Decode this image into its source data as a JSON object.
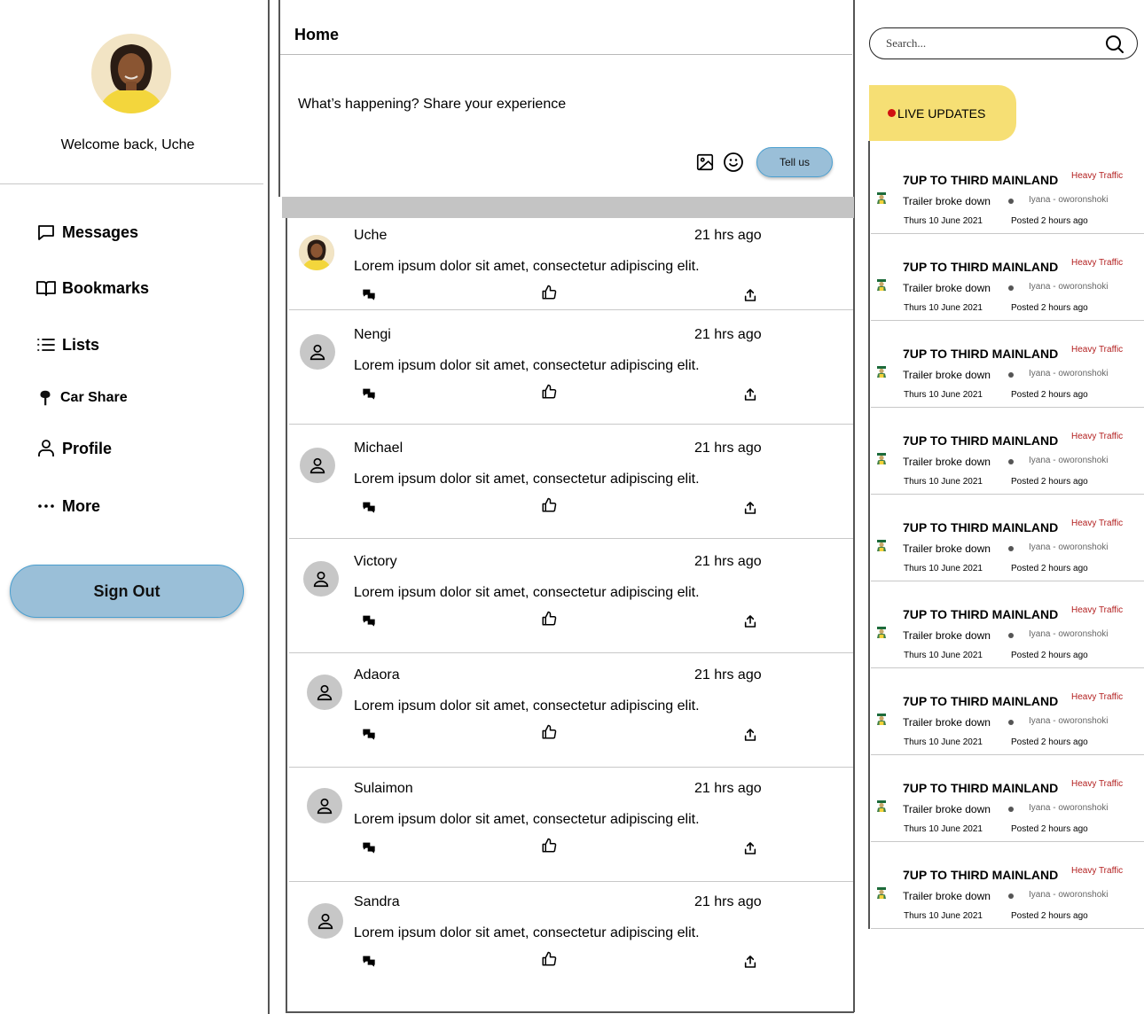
{
  "user": {
    "welcome": "Welcome back, Uche"
  },
  "nav": {
    "messages": "Messages",
    "bookmarks": "Bookmarks",
    "lists": "Lists",
    "car_share": "Car Share",
    "profile": "Profile",
    "more": "More"
  },
  "sign_out": "Sign Out",
  "header": {
    "title": "Home"
  },
  "compose": {
    "prompt": "What’s happening? Share your experience",
    "submit": "Tell us"
  },
  "posts": [
    {
      "name": "Uche",
      "time": "21 hrs ago",
      "text": "Lorem ipsum dolor sit amet, consectetur adipiscing elit."
    },
    {
      "name": "Nengi",
      "time": "21 hrs ago",
      "text": "Lorem ipsum dolor sit amet, consectetur adipiscing elit."
    },
    {
      "name": "Michael",
      "time": "21 hrs ago",
      "text": "Lorem ipsum dolor sit amet, consectetur adipiscing elit."
    },
    {
      "name": "Victory",
      "time": "21 hrs ago",
      "text": "Lorem ipsum dolor sit amet, consectetur adipiscing elit."
    },
    {
      "name": "Adaora",
      "time": "21 hrs ago",
      "text": "Lorem ipsum dolor sit amet, consectetur adipiscing elit."
    },
    {
      "name": "Sulaimon",
      "time": "21 hrs ago",
      "text": "Lorem ipsum dolor sit amet, consectetur adipiscing elit."
    },
    {
      "name": "Sandra",
      "time": "21 hrs ago",
      "text": "Lorem ipsum dolor sit amet, consectetur adipiscing elit."
    }
  ],
  "search": {
    "placeholder": "Search..."
  },
  "live": {
    "label": "LIVE UPDATES",
    "items": [
      {
        "title": "7UP TO THIRD MAINLAND",
        "tag": "Heavy Traffic",
        "desc": "Trailer broke down",
        "location": "Iyana - oworonshoki",
        "date": "Thurs 10 June 2021",
        "posted": "Posted 2 hours ago"
      },
      {
        "title": "7UP TO THIRD MAINLAND",
        "tag": "Heavy Traffic",
        "desc": "Trailer broke down",
        "location": "Iyana - oworonshoki",
        "date": "Thurs 10 June 2021",
        "posted": "Posted 2 hours ago"
      },
      {
        "title": "7UP TO THIRD MAINLAND",
        "tag": "Heavy Traffic",
        "desc": "Trailer broke down",
        "location": "Iyana - oworonshoki",
        "date": "Thurs 10 June 2021",
        "posted": "Posted 2 hours ago"
      },
      {
        "title": "7UP TO THIRD MAINLAND",
        "tag": "Heavy Traffic",
        "desc": "Trailer broke down",
        "location": "Iyana - oworonshoki",
        "date": "Thurs 10 June 2021",
        "posted": "Posted 2 hours ago"
      },
      {
        "title": "7UP TO THIRD MAINLAND",
        "tag": "Heavy Traffic",
        "desc": "Trailer broke down",
        "location": "Iyana - oworonshoki",
        "date": "Thurs 10 June 2021",
        "posted": "Posted 2 hours ago"
      },
      {
        "title": "7UP TO THIRD MAINLAND",
        "tag": "Heavy Traffic",
        "desc": "Trailer broke down",
        "location": "Iyana - oworonshoki",
        "date": "Thurs 10 June 2021",
        "posted": "Posted 2 hours ago"
      },
      {
        "title": "7UP TO THIRD MAINLAND",
        "tag": "Heavy Traffic",
        "desc": "Trailer broke down",
        "location": "Iyana - oworonshoki",
        "date": "Thurs 10 June 2021",
        "posted": "Posted 2 hours ago"
      },
      {
        "title": "7UP TO THIRD MAINLAND",
        "tag": "Heavy Traffic",
        "desc": "Trailer broke down",
        "location": "Iyana - oworonshoki",
        "date": "Thurs 10 June 2021",
        "posted": "Posted 2 hours ago"
      },
      {
        "title": "7UP TO THIRD MAINLAND",
        "tag": "Heavy Traffic",
        "desc": "Trailer broke down",
        "location": "Iyana - oworonshoki",
        "date": "Thurs 10 June 2021",
        "posted": "Posted 2 hours ago"
      }
    ]
  },
  "colors": {
    "button_fill": "#9abfd8",
    "button_border": "#4a9fd0",
    "live_banner": "#f6df74",
    "live_dot": "#d01010",
    "traffic_tag": "#b32020",
    "avatar_placeholder": "#c7c7c7",
    "compose_band": "#c4c4c4"
  }
}
